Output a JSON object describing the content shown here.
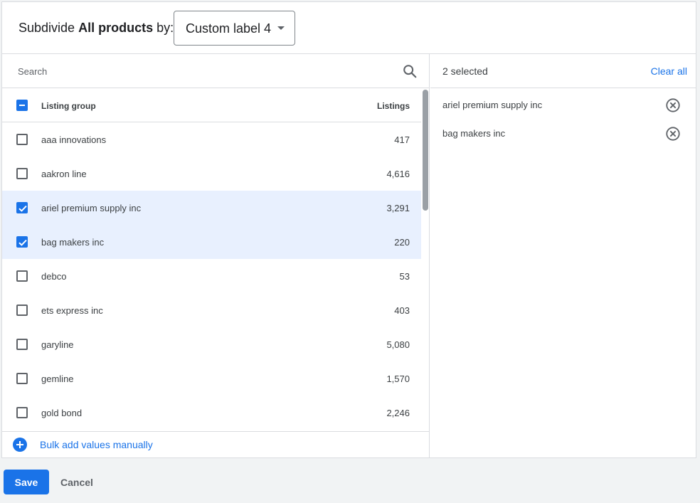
{
  "header": {
    "prefix": "Subdivide",
    "bold": "All products",
    "suffix": "by:",
    "dropdown_value": "Custom label 4"
  },
  "search": {
    "placeholder": "Search"
  },
  "table": {
    "col_group": "Listing group",
    "col_listings": "Listings",
    "rows": [
      {
        "name": "aaa innovations",
        "count": "417",
        "checked": false
      },
      {
        "name": "aakron line",
        "count": "4,616",
        "checked": false
      },
      {
        "name": "ariel premium supply inc",
        "count": "3,291",
        "checked": true
      },
      {
        "name": "bag makers inc",
        "count": "220",
        "checked": true
      },
      {
        "name": "debco",
        "count": "53",
        "checked": false
      },
      {
        "name": "ets express inc",
        "count": "403",
        "checked": false
      },
      {
        "name": "garyline",
        "count": "5,080",
        "checked": false
      },
      {
        "name": "gemline",
        "count": "1,570",
        "checked": false
      },
      {
        "name": "gold bond",
        "count": "2,246",
        "checked": false
      }
    ]
  },
  "bulk": {
    "label": "Bulk add values manually"
  },
  "selection": {
    "count_label": "2 selected",
    "clear_label": "Clear all",
    "items": [
      "ariel premium supply inc",
      "bag makers inc"
    ]
  },
  "footer": {
    "save": "Save",
    "cancel": "Cancel"
  },
  "colors": {
    "accent": "#1a73e8",
    "selected_row": "#e8f0fe"
  },
  "icons": {
    "search": "search-icon",
    "remove": "remove-circle-icon",
    "add": "add-circle-icon",
    "caret": "caret-down-icon"
  }
}
